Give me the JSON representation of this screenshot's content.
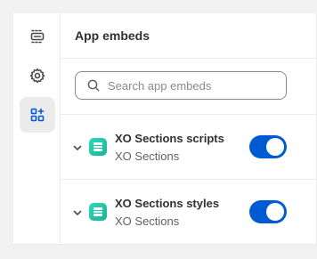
{
  "rail": {
    "items": [
      {
        "name": "sections",
        "icon": "sections-icon",
        "active": false
      },
      {
        "name": "theme-settings",
        "icon": "gear-icon",
        "active": false
      },
      {
        "name": "app-embeds",
        "icon": "app-embeds-icon",
        "active": true
      }
    ]
  },
  "panel": {
    "title": "App embeds",
    "search_placeholder": "Search app embeds",
    "search_value": ""
  },
  "embeds": [
    {
      "name": "XO Sections scripts",
      "app": "XO Sections",
      "enabled": true
    },
    {
      "name": "XO Sections styles",
      "app": "XO Sections",
      "enabled": true
    }
  ],
  "colors": {
    "accent": "#005bd3",
    "app_icon": "#2fd8b8",
    "rail_active": "#ebebeb"
  }
}
